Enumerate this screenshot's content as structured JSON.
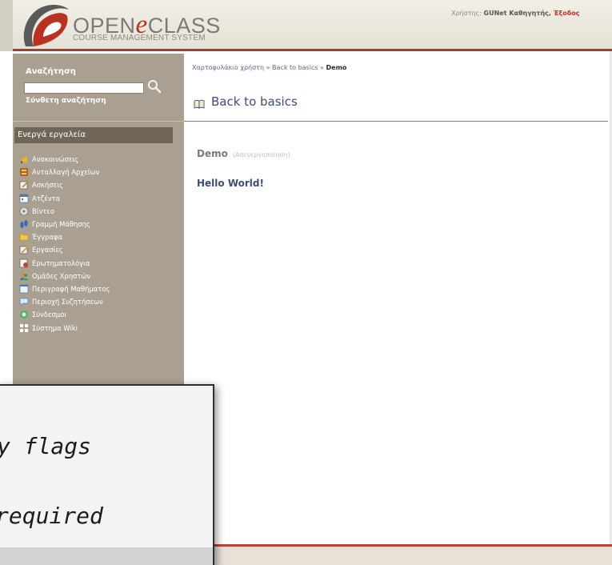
{
  "header": {
    "logo_prefix": "OPEN",
    "logo_e": "e",
    "logo_suffix": "CLASS",
    "logo_subtitle": "COURSE MANAGEMENT SYSTEM",
    "user_label": "Χρήστης: ",
    "user_name": "GUNet Καθηγητής, ",
    "logout_label": "Έξοδος"
  },
  "sidebar": {
    "search_title": "Αναζήτηση",
    "search_value": "",
    "advanced_search": "Σύνθετη αναζήτηση",
    "tools_title": "Ενεργά εργαλεία",
    "tools": [
      {
        "label": "Ανακοινώσεις",
        "icon": "megaphone-icon"
      },
      {
        "label": "Ανταλλαγή Αρχείων",
        "icon": "file-exchange-icon"
      },
      {
        "label": "Ασκήσεις",
        "icon": "exercise-icon"
      },
      {
        "label": "Ατζέντα",
        "icon": "calendar-icon"
      },
      {
        "label": "Βίντεο",
        "icon": "video-icon"
      },
      {
        "label": "Γραμμή Μάθησης",
        "icon": "learning-path-icon"
      },
      {
        "label": "Έγγραφα",
        "icon": "folder-icon"
      },
      {
        "label": "Εργασίες",
        "icon": "assignment-icon"
      },
      {
        "label": "Ερωτηματολόγια",
        "icon": "questionnaire-icon"
      },
      {
        "label": "Ομάδες Χρηστών",
        "icon": "user-groups-icon"
      },
      {
        "label": "Περιγραφή Μαθήματος",
        "icon": "course-description-icon"
      },
      {
        "label": "Περιοχή Συζητήσεων",
        "icon": "forum-icon"
      },
      {
        "label": "Σύνδεσμοι",
        "icon": "links-icon"
      },
      {
        "label": "Σύστημα Wiki",
        "icon": "wiki-icon"
      }
    ]
  },
  "main": {
    "breadcrumb": {
      "home": "Χαρτοφυλάκιο χρήστη",
      "separator": " » ",
      "course": "Back to basics",
      "current": "Demo"
    },
    "course_title": "Back to basics",
    "item_name": "Demo",
    "item_status": "(Απενεργοποίηση)",
    "item_content": "Hello World!"
  },
  "overlay": {
    "line1": "y flags",
    "line2": "required"
  },
  "colors": {
    "accent_red": "#b8321f",
    "sidebar_bg": "#aaa092",
    "tools_header_bg": "#6f6658",
    "title_blue": "#3d4d74"
  }
}
